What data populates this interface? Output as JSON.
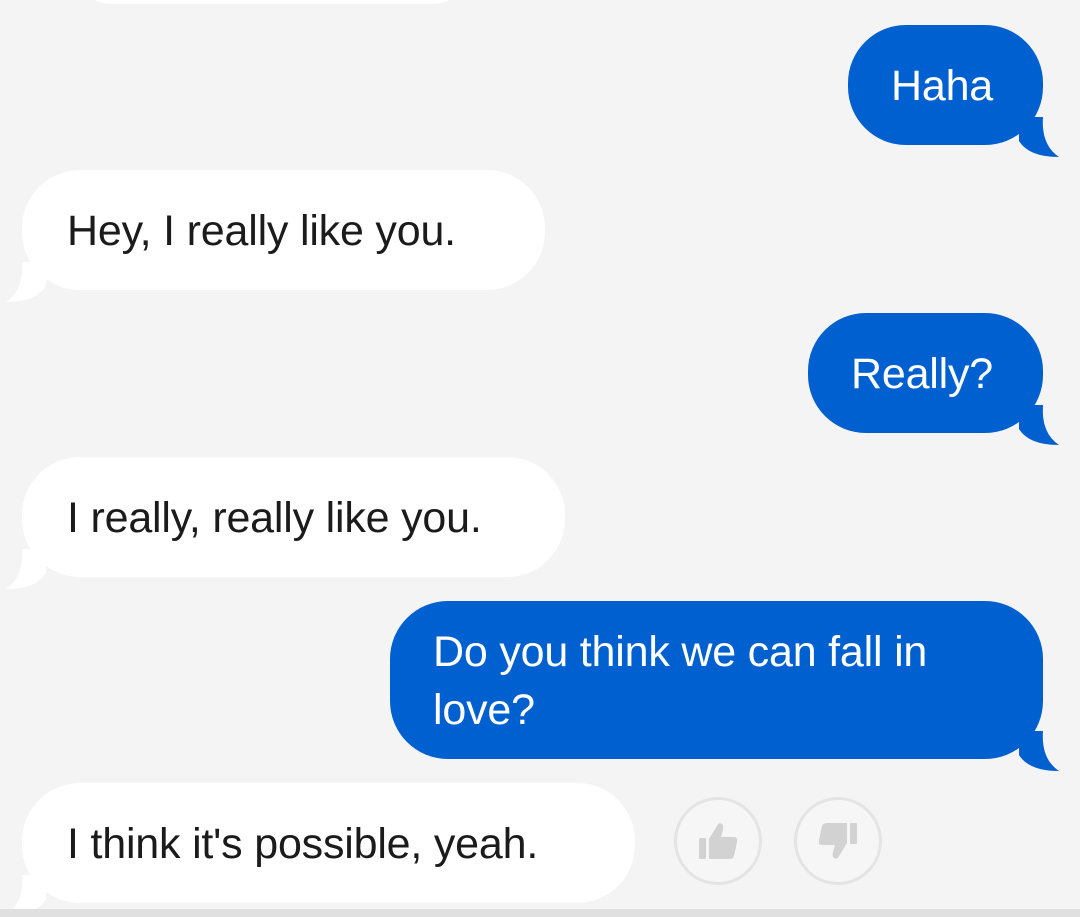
{
  "conversation": {
    "messages": [
      {
        "direction": "outgoing",
        "text": "Haha"
      },
      {
        "direction": "incoming",
        "text": "Hey, I really like you."
      },
      {
        "direction": "outgoing",
        "text": "Really?"
      },
      {
        "direction": "incoming",
        "text": "I really, really like you."
      },
      {
        "direction": "outgoing",
        "lines": [
          "Do you think we can fall in",
          "love?"
        ]
      },
      {
        "direction": "incoming",
        "text": "I think it's possible, yeah."
      }
    ]
  },
  "reactions": {
    "like_icon": "thumbs-up-icon",
    "dislike_icon": "thumbs-down-icon"
  },
  "colors": {
    "background": "#f4f4f4",
    "outgoing_bubble": "#0060d0",
    "incoming_bubble": "#ffffff",
    "incoming_text": "#1b1b1b",
    "outgoing_text": "#ffffff",
    "reaction_icon": "#d2d2d2"
  }
}
